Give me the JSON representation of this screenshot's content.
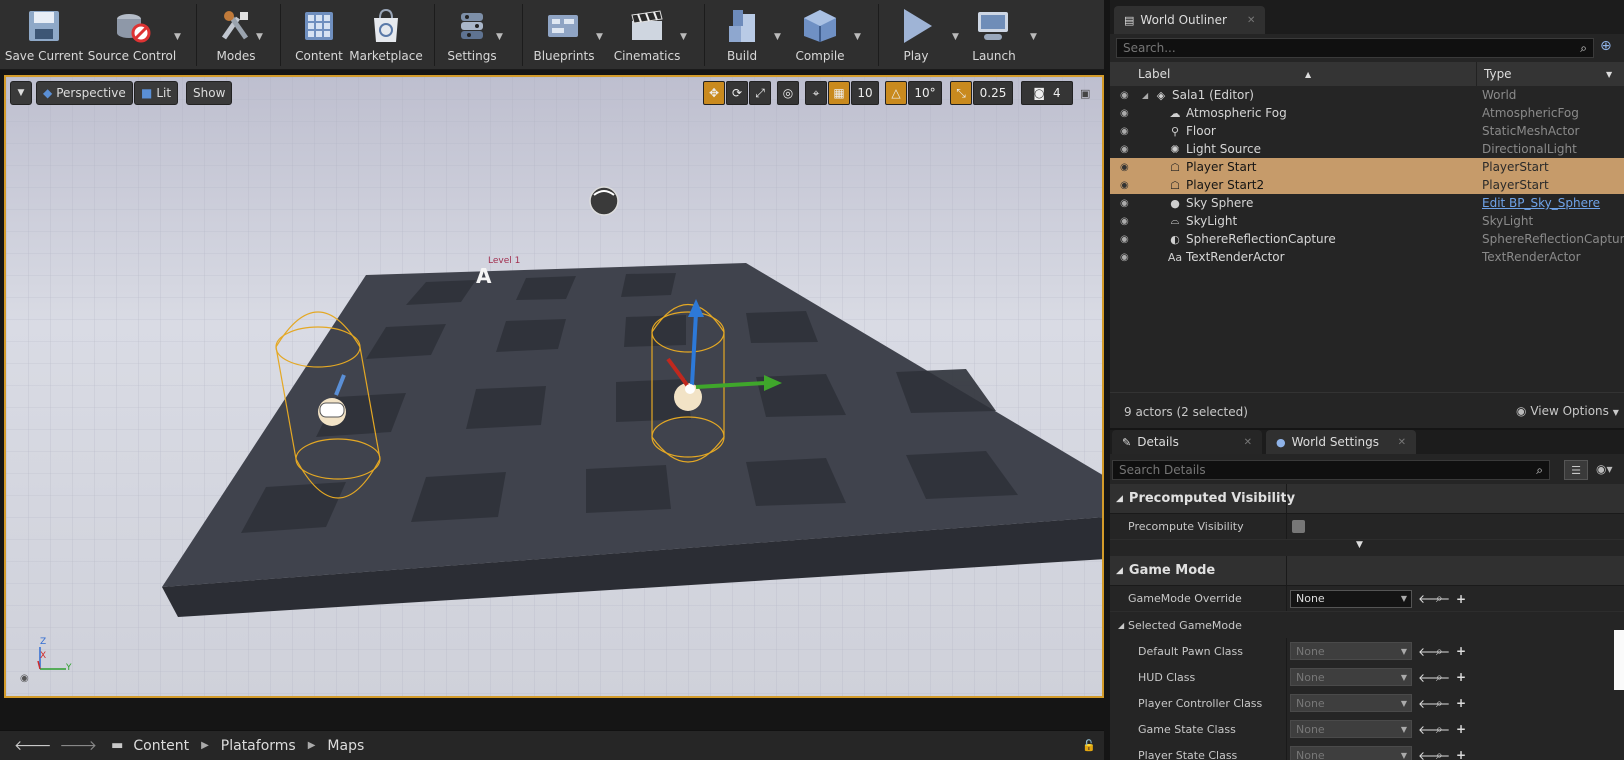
{
  "toolbar": {
    "buttons": [
      {
        "label": "Save Current",
        "icon": "save-icon"
      },
      {
        "label": "Source Control",
        "icon": "source-control-icon"
      },
      {
        "label": "Modes",
        "icon": "modes-icon"
      },
      {
        "label": "Content",
        "icon": "content-icon"
      },
      {
        "label": "Marketplace",
        "icon": "marketplace-icon"
      },
      {
        "label": "Settings",
        "icon": "settings-icon"
      },
      {
        "label": "Blueprints",
        "icon": "blueprints-icon"
      },
      {
        "label": "Cinematics",
        "icon": "cinematics-icon"
      },
      {
        "label": "Build",
        "icon": "build-icon"
      },
      {
        "label": "Compile",
        "icon": "compile-icon"
      },
      {
        "label": "Play",
        "icon": "play-icon"
      },
      {
        "label": "Launch",
        "icon": "launch-icon"
      }
    ]
  },
  "viewport": {
    "perspective": "Perspective",
    "lit": "Lit",
    "show": "Show",
    "grid_snap": "10",
    "rotation_snap": "10°",
    "scale_snap": "0.25",
    "camera_speed": "4",
    "scene_text": "Level 1",
    "axis_z": "Z",
    "axis_x": "X",
    "axis_y": "Y"
  },
  "content_browser": {
    "breadcrumbs": [
      "Content",
      "Plataforms",
      "Maps"
    ]
  },
  "outliner": {
    "tab_title": "World Outliner",
    "search_placeholder": "Search...",
    "col_label": "Label",
    "col_type": "Type",
    "rows": [
      {
        "label": "Sala1 (Editor)",
        "type": "World",
        "selected": false,
        "icon": "world-icon"
      },
      {
        "label": "Atmospheric Fog",
        "type": "AtmosphericFog",
        "selected": false,
        "icon": "fog-icon"
      },
      {
        "label": "Floor",
        "type": "StaticMeshActor",
        "selected": false,
        "icon": "mesh-icon"
      },
      {
        "label": "Light Source",
        "type": "DirectionalLight",
        "selected": false,
        "icon": "light-icon"
      },
      {
        "label": "Player Start",
        "type": "PlayerStart",
        "selected": true,
        "icon": "player-start-icon"
      },
      {
        "label": "Player Start2",
        "type": "PlayerStart",
        "selected": true,
        "icon": "player-start-icon"
      },
      {
        "label": "Sky Sphere",
        "type": "Edit BP_Sky_Sphere",
        "selected": false,
        "icon": "sphere-icon",
        "link": true
      },
      {
        "label": "SkyLight",
        "type": "SkyLight",
        "selected": false,
        "icon": "skylight-icon"
      },
      {
        "label": "SphereReflectionCapture",
        "type": "SphereReflectionCapture",
        "selected": false,
        "icon": "reflection-icon"
      },
      {
        "label": "TextRenderActor",
        "type": "TextRenderActor",
        "selected": false,
        "icon": "text-icon"
      }
    ],
    "status": "9 actors (2 selected)",
    "view_options": "View Options"
  },
  "details": {
    "tab_details": "Details",
    "tab_world_settings": "World Settings",
    "search_placeholder": "Search Details",
    "sections": {
      "precomputed": "Precomputed Visibility",
      "precompute_visibility": "Precompute Visibility",
      "game_mode": "Game Mode",
      "gamemode_override": "GameMode Override",
      "gamemode_override_value": "None",
      "selected_gamemode": "Selected GameMode",
      "properties": [
        {
          "label": "Default Pawn Class",
          "value": "None"
        },
        {
          "label": "HUD Class",
          "value": "None"
        },
        {
          "label": "Player Controller Class",
          "value": "None"
        },
        {
          "label": "Game State Class",
          "value": "None"
        },
        {
          "label": "Player State Class",
          "value": "None"
        }
      ]
    }
  },
  "colors": {
    "selection": "#c69b6a",
    "viewport_border": "#d39b2a",
    "accent_orange": "#c98a1e",
    "link": "#6fa3e8"
  }
}
